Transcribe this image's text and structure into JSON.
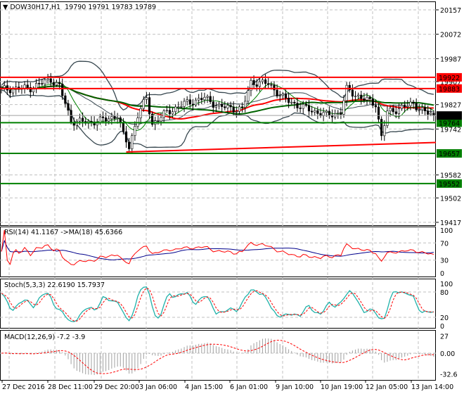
{
  "header": {
    "symbol": "DOW30H17,H1",
    "ohlc": "19790 19791 19783 19789"
  },
  "price_axis": [
    "20157",
    "20072",
    "19987",
    "19907",
    "19827",
    "19742",
    "19582",
    "19502",
    "19417"
  ],
  "levels": [
    {
      "value": 19922,
      "label": "19922",
      "color": "#ff0000"
    },
    {
      "value": 19883,
      "label": "19883",
      "color": "#ff0000"
    },
    {
      "value": 19764,
      "label": "19764",
      "color": "#008000"
    },
    {
      "value": 19657,
      "label": "19657",
      "color": "#008000"
    },
    {
      "value": 19552,
      "label": "19552",
      "color": "#008000"
    }
  ],
  "current_price": {
    "value": 19789,
    "label": "19789"
  },
  "time_axis": [
    "27 Dec 2016",
    "28 Dec 11:00",
    "29 Dec 20:00",
    "3 Jan 06:00",
    "4 Jan 15:00",
    "6 Jan 01:00",
    "9 Jan 10:00",
    "10 Jan 19:00",
    "12 Jan 05:00",
    "13 Jan 14:00"
  ],
  "rsi": {
    "title": "RSI(14) 41.1167  ->MA(18) 45.6366",
    "axis": [
      "100",
      "70",
      "30",
      "0"
    ]
  },
  "stoch": {
    "title": "Stoch(5,3,3) 22.6190 15.7937",
    "axis": [
      "100",
      "80",
      "20",
      "0"
    ]
  },
  "macd": {
    "title": "MACD(12,26,9) -7.2 -3.9",
    "axis": [
      "27",
      "0.00",
      "-32.6"
    ]
  },
  "chart_data": {
    "type": "candlestick",
    "title": "DOW30H17,H1",
    "ylim": [
      19417,
      20157
    ],
    "bars": 150,
    "close_keypoints": [
      [
        0,
        19880
      ],
      [
        10,
        19885
      ],
      [
        17,
        19915
      ],
      [
        20,
        19890
      ],
      [
        24,
        19770
      ],
      [
        30,
        19765
      ],
      [
        36,
        19775
      ],
      [
        40,
        19790
      ],
      [
        42,
        19720
      ],
      [
        44,
        19680
      ],
      [
        47,
        19790
      ],
      [
        50,
        19850
      ],
      [
        52,
        19760
      ],
      [
        57,
        19800
      ],
      [
        63,
        19830
      ],
      [
        70,
        19850
      ],
      [
        75,
        19820
      ],
      [
        83,
        19810
      ],
      [
        86,
        19905
      ],
      [
        92,
        19900
      ],
      [
        97,
        19850
      ],
      [
        103,
        19820
      ],
      [
        112,
        19790
      ],
      [
        117,
        19800
      ],
      [
        119,
        19880
      ],
      [
        124,
        19850
      ],
      [
        129,
        19830
      ],
      [
        131,
        19715
      ],
      [
        133,
        19800
      ],
      [
        139,
        19820
      ],
      [
        142,
        19830
      ],
      [
        146,
        19800
      ],
      [
        149,
        19789
      ]
    ],
    "trendline": {
      "from": [
        43,
        19662
      ],
      "to": [
        150,
        19695
      ]
    },
    "indicators": [
      "MA",
      "Bollinger Bands(20,2)",
      "RSI(14)",
      "Stoch(5,3,3)",
      "MACD(12,26,9)"
    ]
  }
}
